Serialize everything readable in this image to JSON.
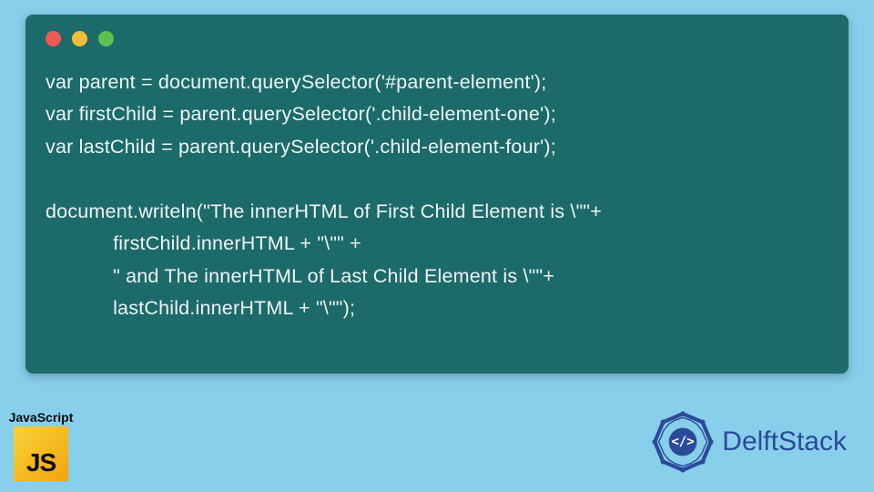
{
  "code": {
    "line1": "var parent = document.querySelector('#parent-element');",
    "line2": "var firstChild = parent.querySelector('.child-element-one');",
    "line3": "var lastChild = parent.querySelector('.child-element-four');",
    "line4": "",
    "line5": "document.writeln(\"The innerHTML of First Child Element is \\\"\"+",
    "line6": "            firstChild.innerHTML + \"\\\"\" +",
    "line7": "            \" and The innerHTML of Last Child Element is \\\"\"+",
    "line8": "            lastChild.innerHTML + \"\\\"\");"
  },
  "jsBadge": {
    "label": "JavaScript",
    "tile": "JS"
  },
  "brand": {
    "name": "DelftStack"
  },
  "colors": {
    "pageBg": "#87cfeb",
    "codeBg": "#1d6a6a",
    "codeText": "#eef6f6",
    "brandBlue": "#2b4b99",
    "jsYellow": "#f2a50d"
  }
}
